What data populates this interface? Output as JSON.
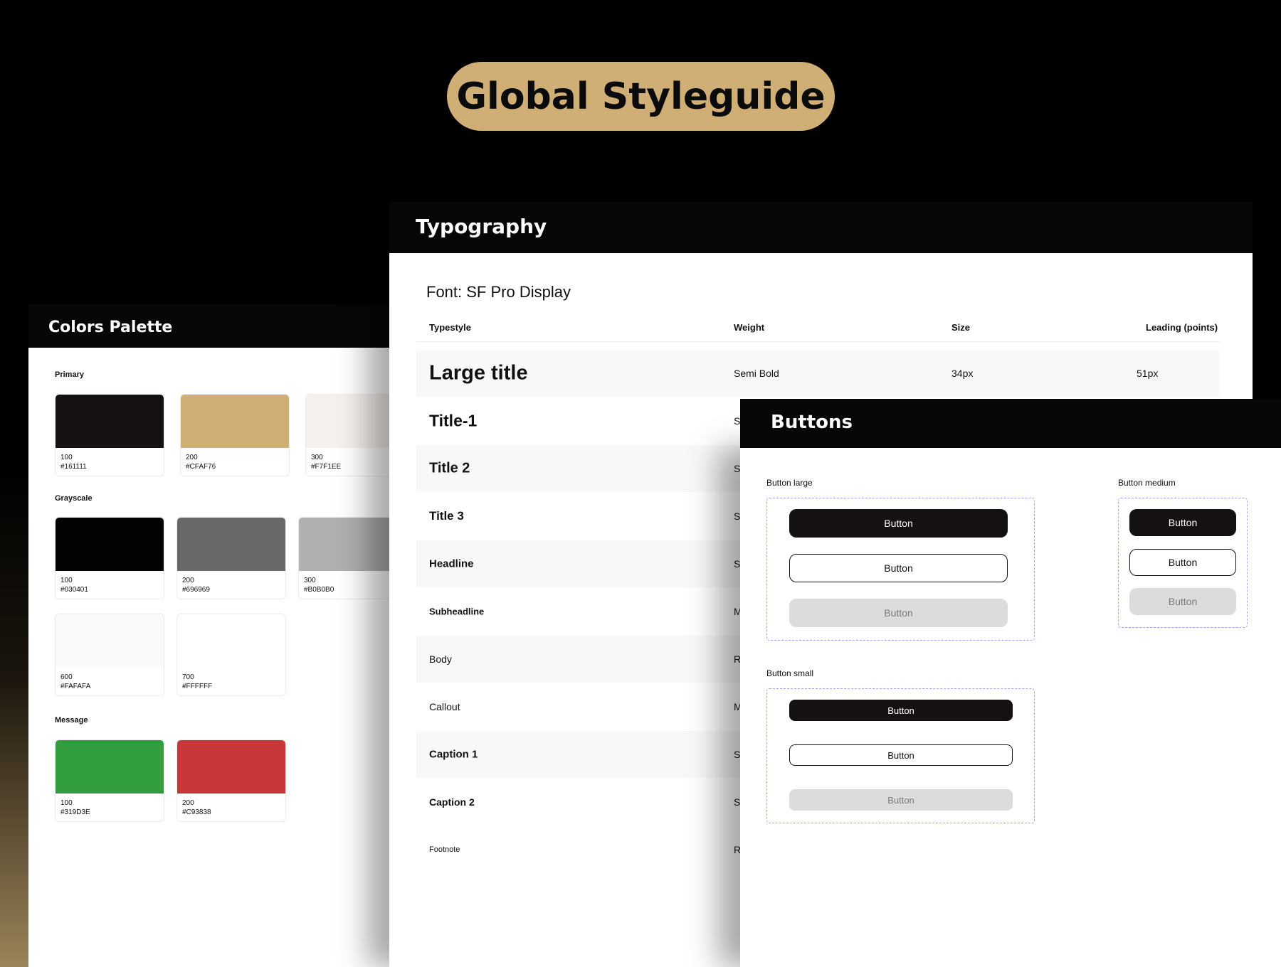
{
  "page_title": "Global Styleguide",
  "colors": {
    "title": "Colors Palette",
    "primary_label": "Primary",
    "grayscale_label": "Grayscale",
    "message_label": "Message",
    "primary": [
      {
        "num": "100",
        "hex": "#161111",
        "color": "#161111"
      },
      {
        "num": "200",
        "hex": "#CFAF76",
        "color": "#CFAF76"
      },
      {
        "num": "300",
        "hex": "#F7F1EE",
        "color": "#F7F1EE"
      }
    ],
    "grayscale": [
      {
        "num": "100",
        "hex": "#030401",
        "color": "#030401"
      },
      {
        "num": "200",
        "hex": "#696969",
        "color": "#696969"
      },
      {
        "num": "300",
        "hex": "#B0B0B0",
        "color": "#B0B0B0"
      },
      {
        "num": "600",
        "hex": "#FAFAFA",
        "color": "#FAFAFA"
      },
      {
        "num": "700",
        "hex": "#FFFFFF",
        "color": "#FFFFFF"
      }
    ],
    "message": [
      {
        "num": "100",
        "hex": "#319D3E",
        "color": "#319D3E"
      },
      {
        "num": "200",
        "hex": "#C93838",
        "color": "#C93838"
      }
    ]
  },
  "typography": {
    "title": "Typography",
    "font": "Font: SF Pro Display",
    "headers": {
      "typestyle": "Typestyle",
      "weight": "Weight",
      "size": "Size",
      "leading": "Leading (points)"
    },
    "rows": [
      {
        "name": "Large title",
        "weight": "Semi Bold",
        "size": "34px",
        "leading": "51px"
      },
      {
        "name": "Title-1",
        "weight": "S"
      },
      {
        "name": "Title 2",
        "weight": "S"
      },
      {
        "name": "Title 3",
        "weight": "S"
      },
      {
        "name": "Headline",
        "weight": "S"
      },
      {
        "name": "Subheadline",
        "weight": "M"
      },
      {
        "name": "Body",
        "weight": "R"
      },
      {
        "name": "Callout",
        "weight": "M"
      },
      {
        "name": "Caption 1",
        "weight": "S"
      },
      {
        "name": "Caption 2",
        "weight": "S"
      },
      {
        "name": "Footnote",
        "weight": "R"
      }
    ]
  },
  "buttons": {
    "title": "Buttons",
    "large_label": "Button large",
    "medium_label": "Button medium",
    "small_label": "Button small",
    "button_text": "Button"
  },
  "accent_color": "#CFAF76"
}
